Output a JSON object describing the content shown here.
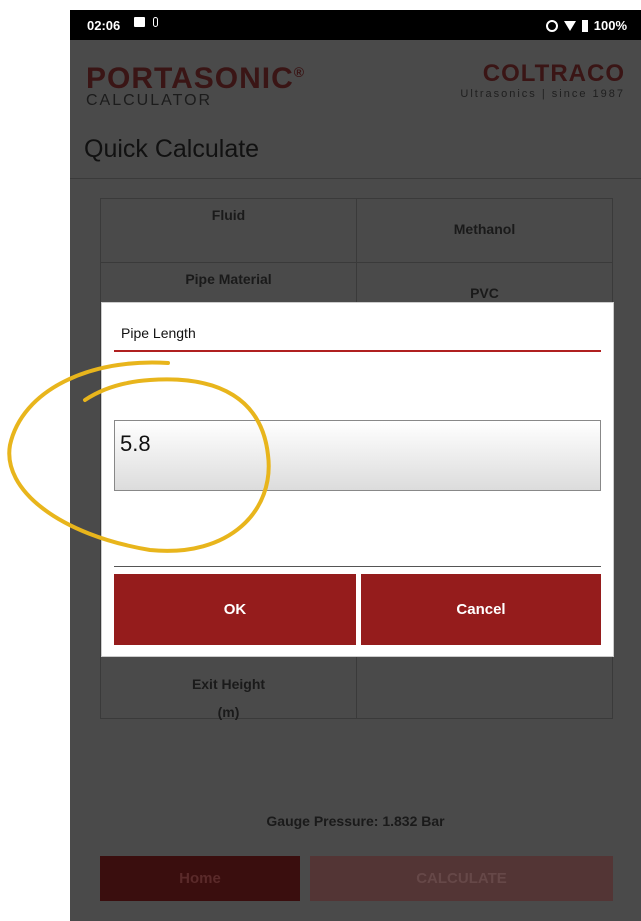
{
  "status_bar": {
    "time": "02:06",
    "battery": "100%"
  },
  "header": {
    "logo_main": "PORTASONIC",
    "logo_registered": "®",
    "logo_sub": "CALCULATOR",
    "brand_main": "COLTRACO",
    "brand_sub": "Ultrasonics | since 1987"
  },
  "page_title": "Quick Calculate",
  "table": {
    "rows": [
      {
        "label": "Fluid",
        "value": "Methanol"
      },
      {
        "label": "Pipe Material",
        "value": "PVC"
      },
      {
        "label": "Exit Height",
        "unit": "(m)",
        "value": ""
      }
    ]
  },
  "footer": {
    "gauge_pressure": "Gauge Pressure: 1.832 Bar",
    "home_label": "Home",
    "calculate_label": "CALCULATE"
  },
  "dialog": {
    "title": "Pipe Length",
    "input_value": "5.8",
    "ok_label": "OK",
    "cancel_label": "Cancel"
  },
  "colors": {
    "accent_red": "#951c1c",
    "annotation_yellow": "#e8b51c"
  }
}
